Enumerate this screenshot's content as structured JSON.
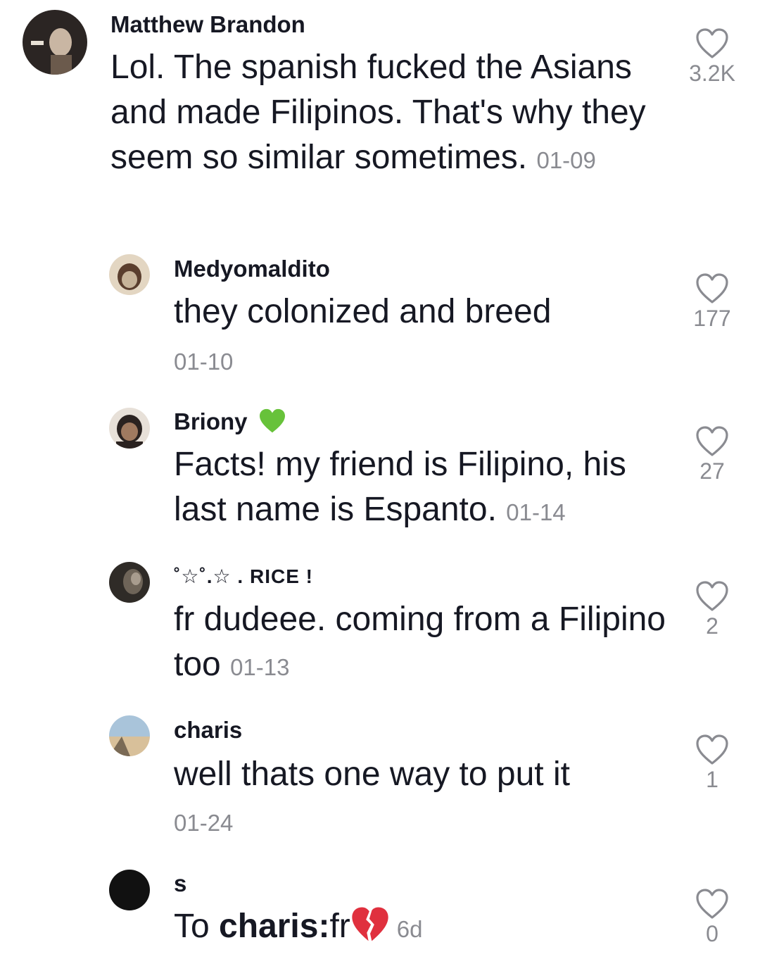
{
  "comments": [
    {
      "username": "Matthew Brandon",
      "text": "Lol. The spanish fucked the Asians and made Filipinos. That's why they seem so similar sometimes.",
      "date": "01-09",
      "likes": "3.2K",
      "avatar_colors": [
        "#2b2523",
        "#6b5a4c",
        "#c9b6a3"
      ]
    },
    {
      "username": "Medyomaldito",
      "text": "they colonized and breed",
      "date": "01-10",
      "likes": "177",
      "avatar_colors": [
        "#c7b49a",
        "#5a3e2e",
        "#e3d6c2"
      ]
    },
    {
      "username": "Briony",
      "username_emoji": "green-heart",
      "text": "Facts! my friend is Filipino, his last name is Espanto.",
      "date": "01-14",
      "likes": "27",
      "avatar_colors": [
        "#2a2220",
        "#a07a60",
        "#e7e0d8"
      ]
    },
    {
      "username": "˚☆˚.☆ . RICE !",
      "text": "fr dudeee. coming from a Filipino too",
      "date": "01-13",
      "likes": "2",
      "avatar_colors": [
        "#2f2b27",
        "#6e6458",
        "#a89c8e"
      ]
    },
    {
      "username": "charis",
      "text": "well thats one way to put it",
      "date": "01-24",
      "likes": "1",
      "avatar_colors": [
        "#a9c4da",
        "#d8c09a",
        "#7a6a55"
      ]
    },
    {
      "username": "s",
      "reply_to_prefix": "To ",
      "reply_to_name": "charis",
      "reply_colon": ":",
      "text": "fr",
      "text_emoji": "broken-heart",
      "date": "6d",
      "likes": "0",
      "avatar_colors": [
        "#111111"
      ]
    }
  ],
  "colors": {
    "text": "#161823",
    "muted": "#8a8b91",
    "heart_outline": "#8a8b91",
    "green_heart": "#67c23a",
    "broken_heart": "#e0303e"
  }
}
